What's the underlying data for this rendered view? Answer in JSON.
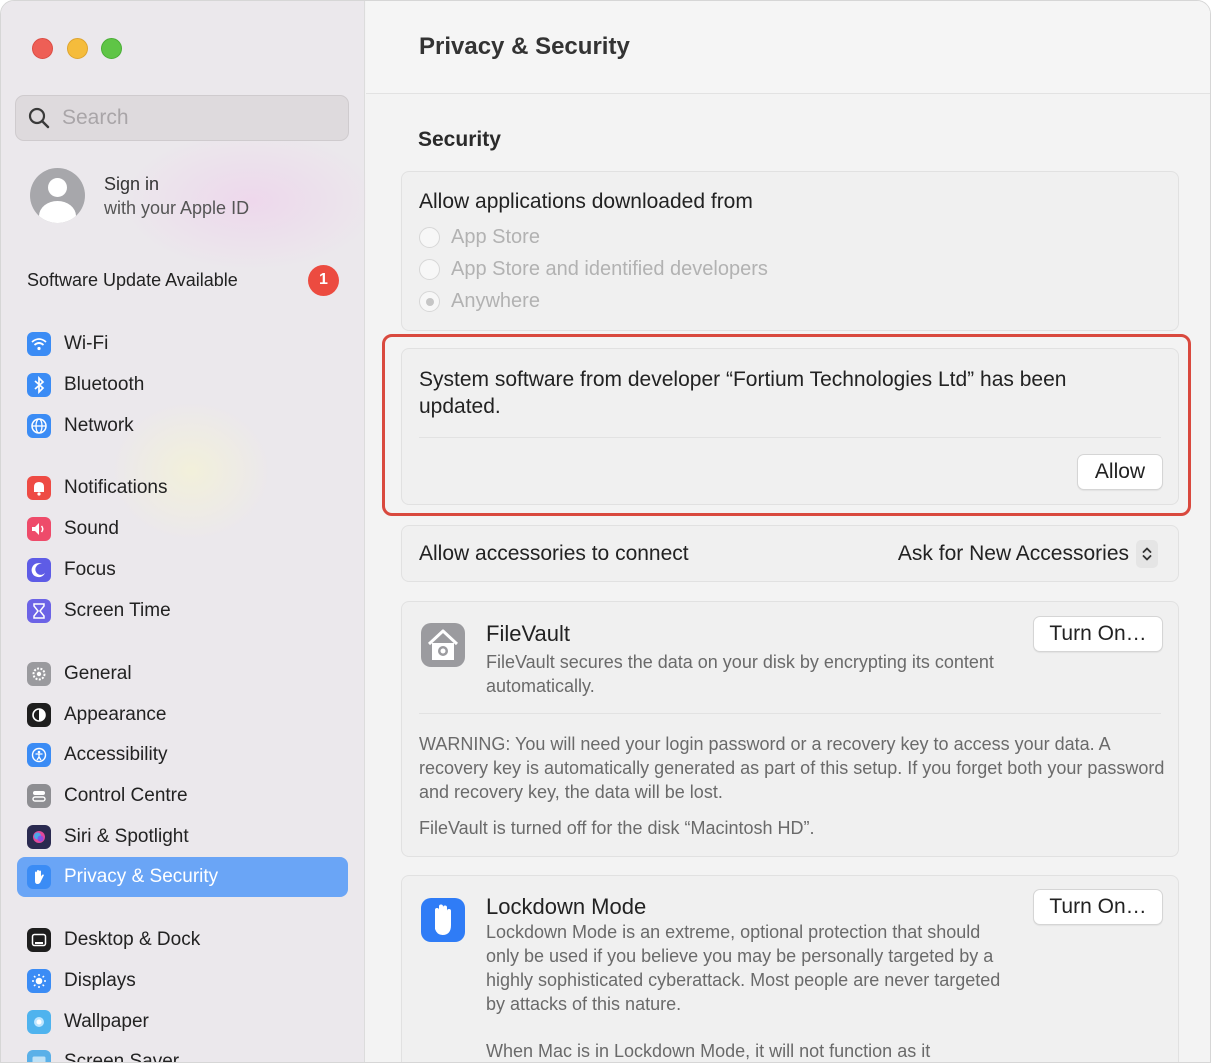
{
  "window": {
    "title": "Privacy & Security"
  },
  "sidebar": {
    "search_placeholder": "Search",
    "account": {
      "line1": "Sign in",
      "line2": "with your Apple ID"
    },
    "update": {
      "label": "Software Update Available",
      "badge": "1"
    },
    "items": [
      {
        "label": "Wi-Fi",
        "icon": "wifi-icon",
        "color": "#3b8cf5"
      },
      {
        "label": "Bluetooth",
        "icon": "bluetooth-icon",
        "color": "#3b8cf5"
      },
      {
        "label": "Network",
        "icon": "globe-icon",
        "color": "#3b8cf5"
      },
      {
        "label": "Notifications",
        "icon": "bell-icon",
        "color": "#ee4b44"
      },
      {
        "label": "Sound",
        "icon": "speaker-icon",
        "color": "#ee4b6a"
      },
      {
        "label": "Focus",
        "icon": "moon-icon",
        "color": "#5e5ce6"
      },
      {
        "label": "Screen Time",
        "icon": "hourglass-icon",
        "color": "#6c63e6"
      },
      {
        "label": "General",
        "icon": "gear-icon",
        "color": "#9a9a9e"
      },
      {
        "label": "Appearance",
        "icon": "appearance-icon",
        "color": "#1e1e1e"
      },
      {
        "label": "Accessibility",
        "icon": "accessibility-icon",
        "color": "#3b8cf5"
      },
      {
        "label": "Control Centre",
        "icon": "control-centre-icon",
        "color": "#8e8e92"
      },
      {
        "label": "Siri & Spotlight",
        "icon": "siri-icon",
        "color": "#2a2a50"
      },
      {
        "label": "Privacy & Security",
        "icon": "hand-icon",
        "color": "#3b8cf5"
      },
      {
        "label": "Desktop & Dock",
        "icon": "dock-icon",
        "color": "#1e1e1e"
      },
      {
        "label": "Displays",
        "icon": "sun-icon",
        "color": "#3b8cf5"
      },
      {
        "label": "Wallpaper",
        "icon": "wallpaper-icon",
        "color": "#4fb3ee"
      },
      {
        "label": "Screen Saver",
        "icon": "screen-saver-icon",
        "color": "#5ab0e8"
      }
    ]
  },
  "main": {
    "section_heading": "Security",
    "allow_from": {
      "title": "Allow applications downloaded from",
      "options": [
        "App Store",
        "App Store and identified developers",
        "Anywhere"
      ],
      "selected": "Anywhere"
    },
    "system_software": {
      "message": "System software from developer “Fortium Technologies Ltd” has been updated.",
      "button": "Allow"
    },
    "accessories": {
      "label": "Allow accessories to connect",
      "value": "Ask for New Accessories"
    },
    "filevault": {
      "title": "FileVault",
      "description": "FileVault secures the data on your disk by encrypting its content automatically.",
      "button": "Turn On…",
      "warning": "WARNING: You will need your login password or a recovery key to access your data. A recovery key is automatically generated as part of this setup. If you forget both your password and recovery key, the data will be lost.",
      "status": "FileVault is turned off for the disk “Macintosh HD”."
    },
    "lockdown": {
      "title": "Lockdown Mode",
      "description": "Lockdown Mode is an extreme, optional protection that should only be used if you believe you may be personally targeted by a highly sophisticated cyberattack. Most people are never targeted by attacks of this nature.",
      "description2": "When Mac is in Lockdown Mode, it will not function as it",
      "button": "Turn On…"
    },
    "colors": {
      "accent": "#6aa5f6",
      "highlight_border": "#d9493e",
      "badge": "#ec4b40"
    }
  }
}
